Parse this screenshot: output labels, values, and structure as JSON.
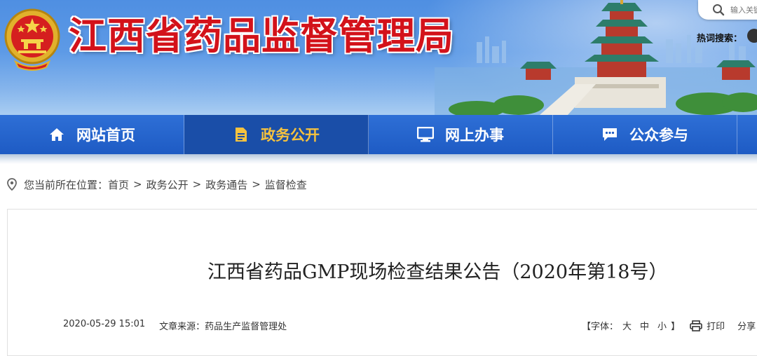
{
  "header": {
    "site_title": "江西省药品监督管理局",
    "search_placeholder": "输入关键字",
    "hot_search_label": "热词搜索："
  },
  "nav": [
    {
      "label": "网站首页",
      "icon": "home-icon"
    },
    {
      "label": "政务公开",
      "icon": "document-icon"
    },
    {
      "label": "网上办事",
      "icon": "monitor-icon"
    },
    {
      "label": "公众参与",
      "icon": "chat-icon"
    }
  ],
  "breadcrumb": {
    "prefix": "您当前所在位置：",
    "items": [
      "首页",
      "政务公开",
      "政务通告",
      "监督检查"
    ],
    "separator": ">"
  },
  "article": {
    "title": "江西省药品GMP现场检查结果公告（2020年第18号）",
    "date": "2020-05-29 15:01",
    "source_label": "文章来源：",
    "source": "药品生产监督管理处"
  },
  "tools": {
    "font_label_open": "【字体：",
    "font_large": "大",
    "font_medium": "中",
    "font_small": "小",
    "font_label_close": "】",
    "print_label": "打印",
    "share_label": "分享"
  },
  "colors": {
    "title_red": "#d3121a",
    "nav_blue": "#1e5bc4",
    "nav_active": "#1a4ea8",
    "nav_active_text": "#f6c23e"
  }
}
